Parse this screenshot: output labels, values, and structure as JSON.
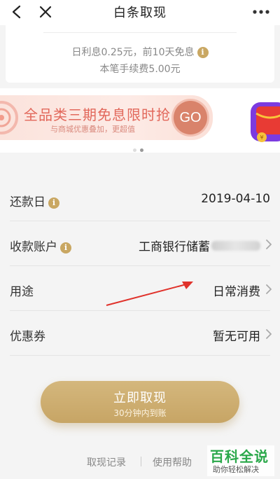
{
  "nav": {
    "title": "白条取现",
    "back_icon": "back-arrow-icon",
    "close_icon": "close-icon",
    "more_icon": "more-dots-icon"
  },
  "info": {
    "interest_text": "日利息0.25元，前10天免息",
    "fee_text": "本笔手续费5.00元"
  },
  "banner": {
    "headline": "全品类三期免息限时抢",
    "subtext": "与商城优惠叠加，更超值",
    "go_label": "GO",
    "carousel_total": 2,
    "carousel_active": 2
  },
  "form": {
    "repay_date": {
      "label": "还款日",
      "value": "2019-04-10"
    },
    "account": {
      "label": "收款账户",
      "value": "工商银行储蓄"
    },
    "purpose": {
      "label": "用途",
      "value": "日常消费"
    },
    "coupon": {
      "label": "优惠券",
      "value": "暂无可用"
    }
  },
  "cta": {
    "label": "立即取现",
    "sublabel": "30分钟内到账"
  },
  "footer": {
    "records_link": "取现记录",
    "help_link": "使用帮助"
  },
  "watermark": {
    "title": "百科全说",
    "subtitle": "助你轻松解决"
  },
  "colors": {
    "gold": "#c9a762",
    "banner_text": "#e2685b",
    "watermark_green": "#2aa84a",
    "annotation_arrow": "#e0322b"
  }
}
